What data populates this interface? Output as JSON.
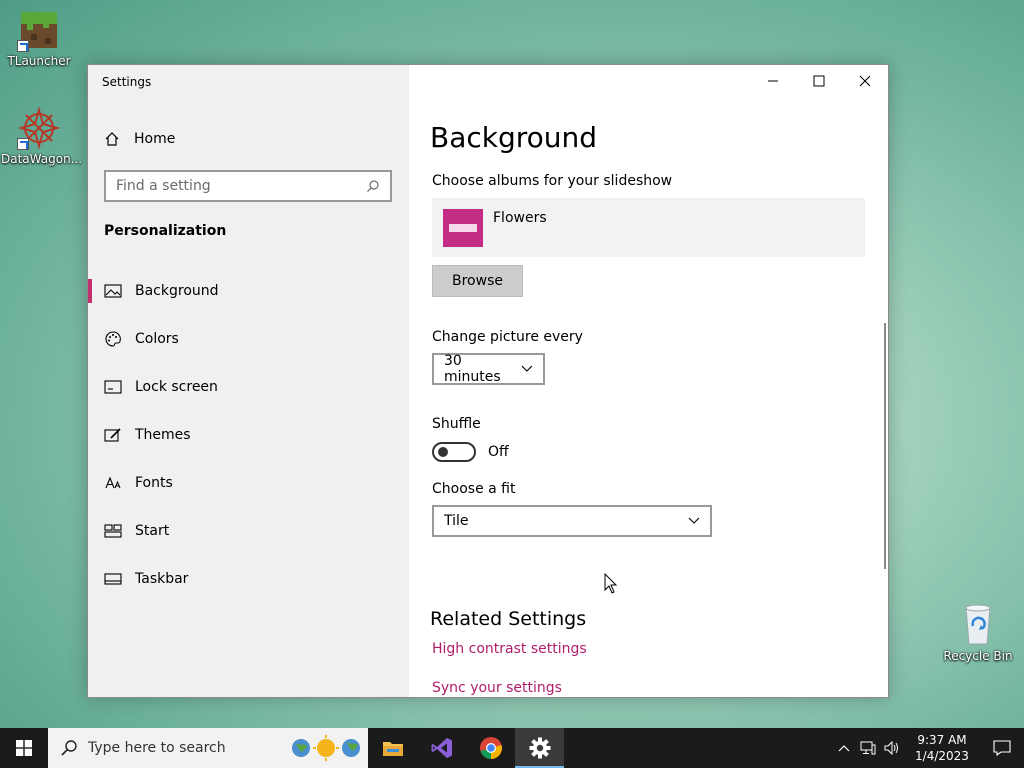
{
  "desktop": {
    "icons": [
      {
        "label": "TLauncher"
      },
      {
        "label": "DataWagon..."
      }
    ],
    "recycle_bin": {
      "label": "Recycle Bin"
    }
  },
  "window": {
    "title": "Settings",
    "controls": {
      "minimize": "minimize-icon",
      "maximize": "maximize-icon",
      "close": "close-icon"
    }
  },
  "sidebar": {
    "home_label": "Home",
    "search": {
      "placeholder": "Find a setting"
    },
    "section_title": "Personalization",
    "items": [
      {
        "label": "Background",
        "icon": "picture-icon",
        "active": true
      },
      {
        "label": "Colors",
        "icon": "palette-icon"
      },
      {
        "label": "Lock screen",
        "icon": "lock-screen-icon"
      },
      {
        "label": "Themes",
        "icon": "themes-icon"
      },
      {
        "label": "Fonts",
        "icon": "fonts-icon"
      },
      {
        "label": "Start",
        "icon": "start-icon"
      },
      {
        "label": "Taskbar",
        "icon": "taskbar-icon"
      }
    ]
  },
  "main": {
    "title": "Background",
    "albums_label": "Choose albums for your slideshow",
    "album_name": "Flowers",
    "browse_label": "Browse",
    "change_picture_label": "Change picture every",
    "change_picture_value": "30 minutes",
    "shuffle_label": "Shuffle",
    "shuffle_state": "Off",
    "fit_label": "Choose a fit",
    "fit_value": "Tile",
    "related_title": "Related Settings",
    "links": [
      "High contrast settings",
      "Sync your settings"
    ]
  },
  "taskbar": {
    "search_placeholder": "Type here to search",
    "time": "9:37 AM",
    "date": "1/4/2023"
  },
  "colors": {
    "accent": "#c2306f",
    "link": "#b01e6a",
    "album_thumb": "#c42d86"
  }
}
